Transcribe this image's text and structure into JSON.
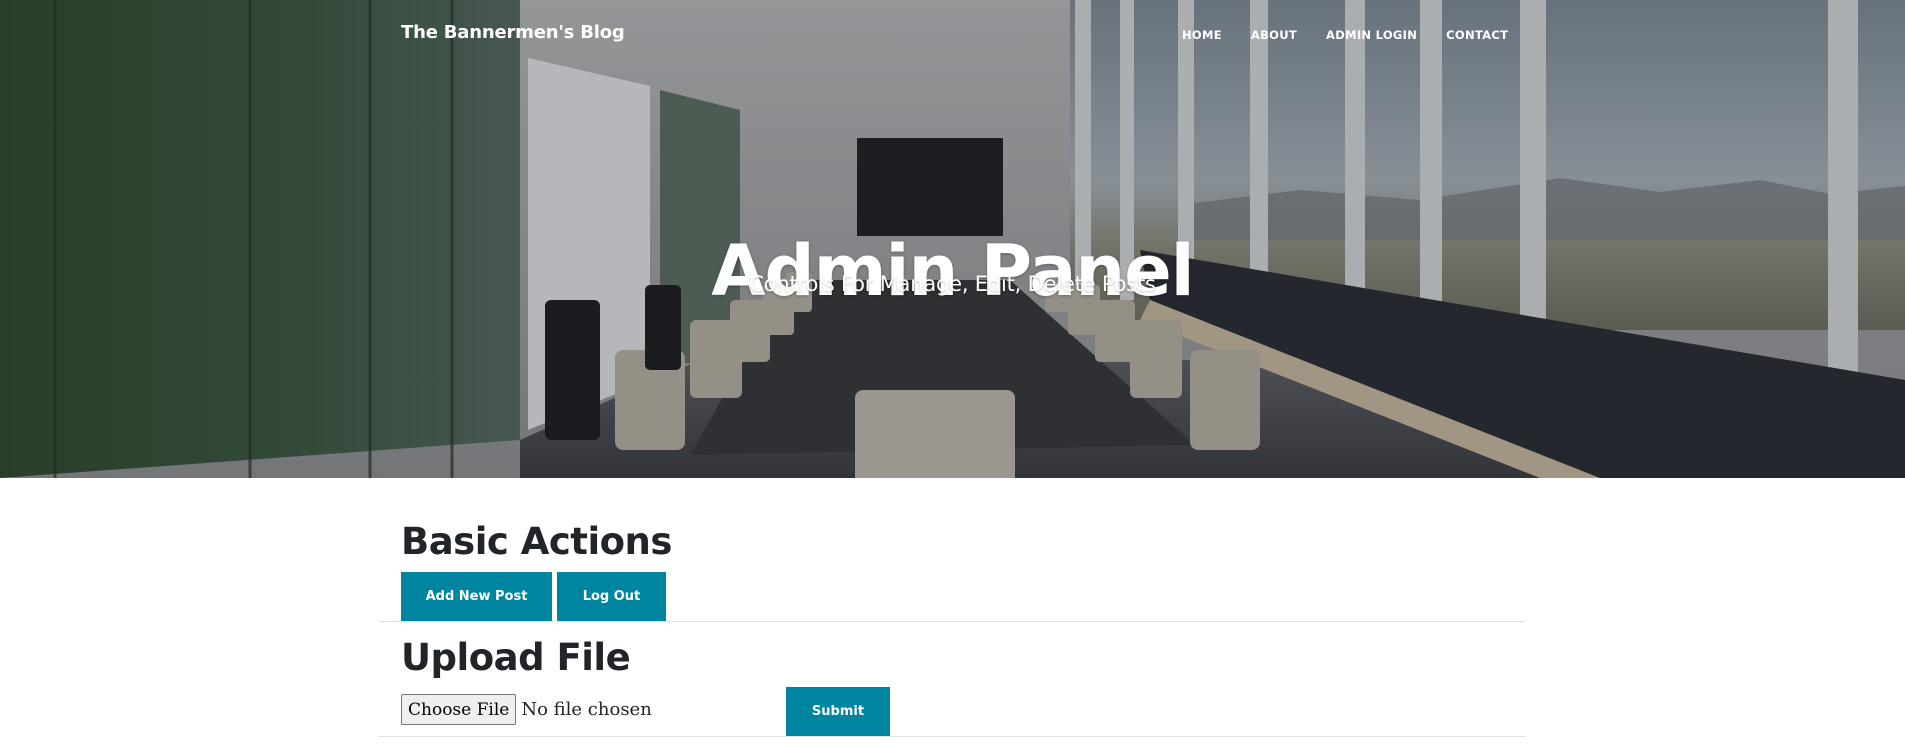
{
  "navbar": {
    "brand": "The Bannermen's Blog",
    "links": [
      "HOME",
      "ABOUT",
      "ADMIN LOGIN",
      "CONTACT"
    ]
  },
  "hero": {
    "title": "Admin Panel",
    "subtitle": "Controls For Manage, Edit, Delete Posts"
  },
  "basic_actions": {
    "heading": "Basic Actions",
    "add_post_label": "Add New Post",
    "logout_label": "Log Out"
  },
  "upload": {
    "heading": "Upload File",
    "choose_label": "Choose File",
    "status": "No file chosen",
    "submit_label": "Submit"
  },
  "colors": {
    "primary": "#0085a1",
    "heading": "#212529",
    "divider": "#dee2e6"
  }
}
